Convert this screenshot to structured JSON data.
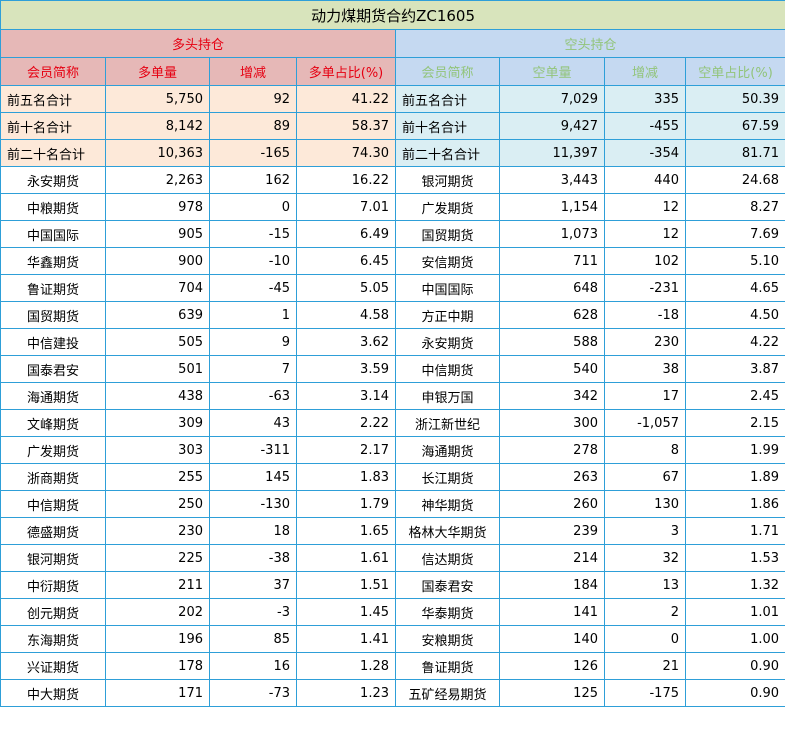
{
  "title": "动力煤期货合约ZC1605",
  "long_section": "多头持仓",
  "short_section": "空头持仓",
  "long_headers": [
    "会员简称",
    "多单量",
    "增减",
    "多单占比(%)"
  ],
  "short_headers": [
    "会员简称",
    "空单量",
    "增减",
    "空单占比(%)"
  ],
  "summary_rows": [
    {
      "long": [
        "前五名合计",
        "5,750",
        "92",
        "41.22"
      ],
      "short": [
        "前五名合计",
        "7,029",
        "335",
        "50.39"
      ]
    },
    {
      "long": [
        "前十名合计",
        "8,142",
        "89",
        "58.37"
      ],
      "short": [
        "前十名合计",
        "9,427",
        "-455",
        "67.59"
      ]
    },
    {
      "long": [
        "前二十名合计",
        "10,363",
        "-165",
        "74.30"
      ],
      "short": [
        "前二十名合计",
        "11,397",
        "-354",
        "81.71"
      ]
    }
  ],
  "rows": [
    {
      "long": [
        "永安期货",
        "2,263",
        "162",
        "16.22"
      ],
      "short": [
        "银河期货",
        "3,443",
        "440",
        "24.68"
      ]
    },
    {
      "long": [
        "中粮期货",
        "978",
        "0",
        "7.01"
      ],
      "short": [
        "广发期货",
        "1,154",
        "12",
        "8.27"
      ]
    },
    {
      "long": [
        "中国国际",
        "905",
        "-15",
        "6.49"
      ],
      "short": [
        "国贸期货",
        "1,073",
        "12",
        "7.69"
      ]
    },
    {
      "long": [
        "华鑫期货",
        "900",
        "-10",
        "6.45"
      ],
      "short": [
        "安信期货",
        "711",
        "102",
        "5.10"
      ]
    },
    {
      "long": [
        "鲁证期货",
        "704",
        "-45",
        "5.05"
      ],
      "short": [
        "中国国际",
        "648",
        "-231",
        "4.65"
      ]
    },
    {
      "long": [
        "国贸期货",
        "639",
        "1",
        "4.58"
      ],
      "short": [
        "方正中期",
        "628",
        "-18",
        "4.50"
      ]
    },
    {
      "long": [
        "中信建投",
        "505",
        "9",
        "3.62"
      ],
      "short": [
        "永安期货",
        "588",
        "230",
        "4.22"
      ]
    },
    {
      "long": [
        "国泰君安",
        "501",
        "7",
        "3.59"
      ],
      "short": [
        "中信期货",
        "540",
        "38",
        "3.87"
      ]
    },
    {
      "long": [
        "海通期货",
        "438",
        "-63",
        "3.14"
      ],
      "short": [
        "申银万国",
        "342",
        "17",
        "2.45"
      ]
    },
    {
      "long": [
        "文峰期货",
        "309",
        "43",
        "2.22"
      ],
      "short": [
        "浙江新世纪",
        "300",
        "-1,057",
        "2.15"
      ]
    },
    {
      "long": [
        "广发期货",
        "303",
        "-311",
        "2.17"
      ],
      "short": [
        "海通期货",
        "278",
        "8",
        "1.99"
      ]
    },
    {
      "long": [
        "浙商期货",
        "255",
        "145",
        "1.83"
      ],
      "short": [
        "长江期货",
        "263",
        "67",
        "1.89"
      ]
    },
    {
      "long": [
        "中信期货",
        "250",
        "-130",
        "1.79"
      ],
      "short": [
        "神华期货",
        "260",
        "130",
        "1.86"
      ]
    },
    {
      "long": [
        "德盛期货",
        "230",
        "18",
        "1.65"
      ],
      "short": [
        "格林大华期货",
        "239",
        "3",
        "1.71"
      ]
    },
    {
      "long": [
        "银河期货",
        "225",
        "-38",
        "1.61"
      ],
      "short": [
        "信达期货",
        "214",
        "32",
        "1.53"
      ]
    },
    {
      "long": [
        "中衍期货",
        "211",
        "37",
        "1.51"
      ],
      "short": [
        "国泰君安",
        "184",
        "13",
        "1.32"
      ]
    },
    {
      "long": [
        "创元期货",
        "202",
        "-3",
        "1.45"
      ],
      "short": [
        "华泰期货",
        "141",
        "2",
        "1.01"
      ]
    },
    {
      "long": [
        "东海期货",
        "196",
        "85",
        "1.41"
      ],
      "short": [
        "安粮期货",
        "140",
        "0",
        "1.00"
      ]
    },
    {
      "long": [
        "兴证期货",
        "178",
        "16",
        "1.28"
      ],
      "short": [
        "鲁证期货",
        "126",
        "21",
        "0.90"
      ]
    },
    {
      "long": [
        "中大期货",
        "171",
        "-73",
        "1.23"
      ],
      "short": [
        "五矿经易期货",
        "125",
        "-175",
        "0.90"
      ]
    }
  ]
}
